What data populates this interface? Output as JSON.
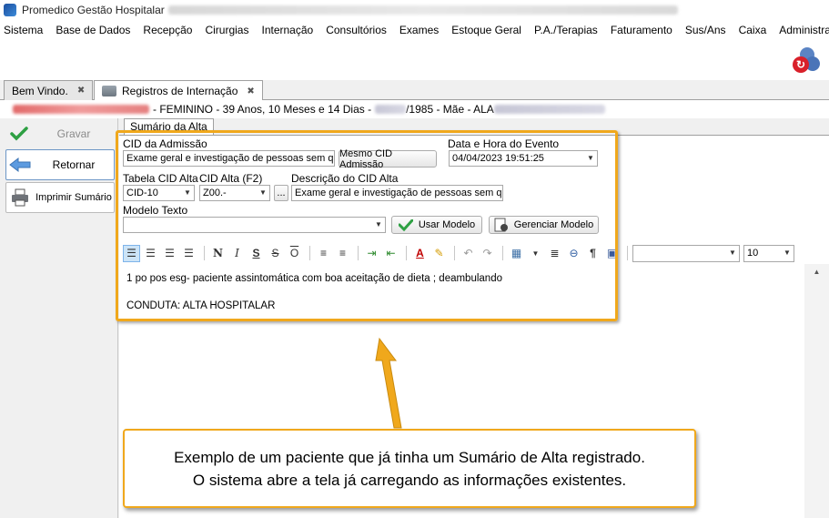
{
  "window": {
    "title": "Promedico Gestão Hospitalar"
  },
  "menu": [
    "Sistema",
    "Base de Dados",
    "Recepção",
    "Cirurgias",
    "Internação",
    "Consultórios",
    "Exames",
    "Estoque Geral",
    "P.A./Terapias",
    "Faturamento",
    "Sus/Ans",
    "Caixa",
    "Administração"
  ],
  "tabs": [
    {
      "label": "Bem Vindo.",
      "close": "✖"
    },
    {
      "label": "Registros de Internação",
      "close": "✖"
    }
  ],
  "patient": {
    "gender": "- FEMININO - 39 Anos, 10 Meses e 14 Dias -",
    "birth_suffix": "/1985 - Mãe - ALA"
  },
  "sidebar": {
    "gravar": "Gravar",
    "retornar": "Retornar",
    "imprimir": "Imprimir Sumário"
  },
  "form": {
    "subtab": "Sumário da Alta",
    "cid_admissao_label": "CID da Admissão",
    "cid_admissao_value": "Exame geral e investigação de pessoas sem que",
    "mesmo_cid_button": "Mesmo CID Admissão",
    "data_hora_label": "Data e Hora do Evento",
    "data_hora_value": "04/04/2023 19:51:25",
    "tabela_cid_label": "Tabela CID Alta",
    "tabela_cid_value": "CID-10",
    "cid_alta_label": "CID Alta (F2)",
    "cid_alta_value": "Z00.-",
    "ellipsis": "...",
    "descricao_label": "Descrição do CID Alta",
    "descricao_value": "Exame geral e investigação de pessoas sem que",
    "modelo_texto_label": "Modelo Texto",
    "usar_modelo": "Usar Modelo",
    "gerenciar_modelo": "Gerenciar Modelo"
  },
  "toolbar": {
    "font_size": "10"
  },
  "editor": {
    "line1": "1 po pos esg- paciente assintomática com boa aceitação de dieta ; deambulando",
    "line2": "CONDUTA: ALTA HOSPITALAR"
  },
  "callout": {
    "line1": "Exemplo de um paciente que já tinha um Sumário de Alta registrado.",
    "line2": "O sistema abre a tela já carregando as informações existentes."
  },
  "colors": {
    "highlight": "#f0a81c",
    "accent_blue": "#6c96c6"
  }
}
